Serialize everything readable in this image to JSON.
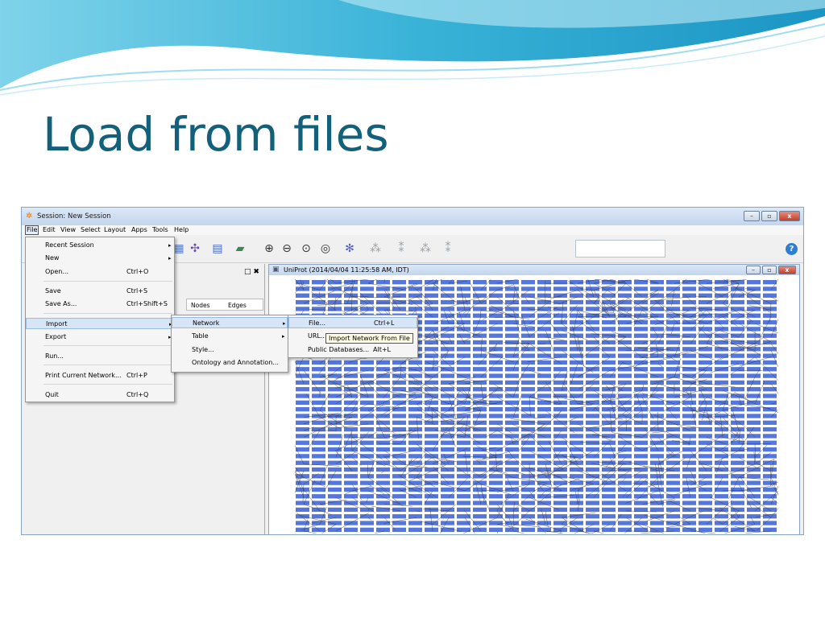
{
  "slide": {
    "title": "Load from files"
  },
  "window": {
    "title": "Session: New Session",
    "minimize": "–",
    "restore": "▫",
    "close": "x"
  },
  "menubar": {
    "items": [
      "File",
      "Edit",
      "View",
      "Select",
      "Layout",
      "Apps",
      "Tools",
      "Help"
    ]
  },
  "file_menu": {
    "items": [
      {
        "label": "Recent Session",
        "shortcut": ""
      },
      {
        "label": "New",
        "shortcut": ""
      },
      {
        "label": "Open...",
        "shortcut": "Ctrl+O"
      },
      {
        "label": "Save",
        "shortcut": "Ctrl+S"
      },
      {
        "label": "Save As...",
        "shortcut": "Ctrl+Shift+S"
      },
      {
        "label": "Import",
        "shortcut": ""
      },
      {
        "label": "Export",
        "shortcut": ""
      },
      {
        "label": "Run...",
        "shortcut": ""
      },
      {
        "label": "Print Current Network...",
        "shortcut": "Ctrl+P"
      },
      {
        "label": "Quit",
        "shortcut": "Ctrl+Q"
      }
    ]
  },
  "import_menu": {
    "items": [
      "Network",
      "Table",
      "Style...",
      "Ontology and Annotation..."
    ]
  },
  "network_menu": {
    "items": [
      {
        "label": "File...",
        "shortcut": "Ctrl+L"
      },
      {
        "label": "URL...",
        "shortcut": ""
      },
      {
        "label": "Public Databases...",
        "shortcut": "Alt+L"
      }
    ]
  },
  "tooltip": {
    "text": "Import Network From File"
  },
  "left_panel": {
    "columns": [
      "Nodes",
      "Edges"
    ],
    "controls": "□ ✖"
  },
  "network_view": {
    "title": "UniProt (2014/04/04 11:25:58 AM, IDT)"
  },
  "colors": {
    "title": "#13607a",
    "node": "#5577dd",
    "edge": "#333333"
  }
}
